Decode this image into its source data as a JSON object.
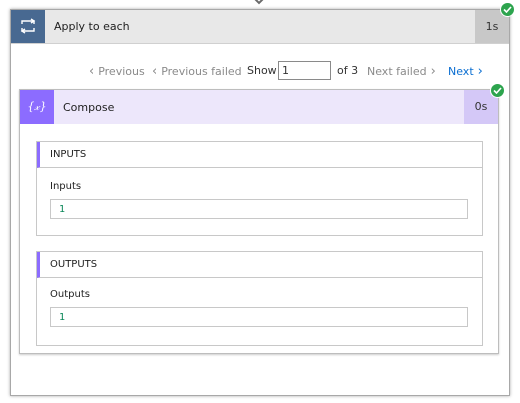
{
  "loop": {
    "title": "Apply to each",
    "duration": "1s",
    "status": "succeeded",
    "icon": "loop-icon"
  },
  "pager": {
    "previous_label": "Previous",
    "previous_failed_label": "Previous failed",
    "show_label": "Show",
    "current_page": "1",
    "of_label": "of 3",
    "next_failed_label": "Next failed",
    "next_label": "Next"
  },
  "compose": {
    "title": "Compose",
    "duration": "0s",
    "status": "succeeded",
    "icon_glyph": "{𝓍}",
    "icon": "compose-icon"
  },
  "inputs": {
    "section_title": "INPUTS",
    "field_label": "Inputs",
    "value": "1"
  },
  "outputs": {
    "section_title": "OUTPUTS",
    "field_label": "Outputs",
    "value": "1"
  },
  "colors": {
    "loop_accent": "#486991",
    "compose_accent": "#8c6cff",
    "compose_header_bg": "#ede7fb",
    "success": "#2da44e",
    "link": "#0a6ed1"
  }
}
